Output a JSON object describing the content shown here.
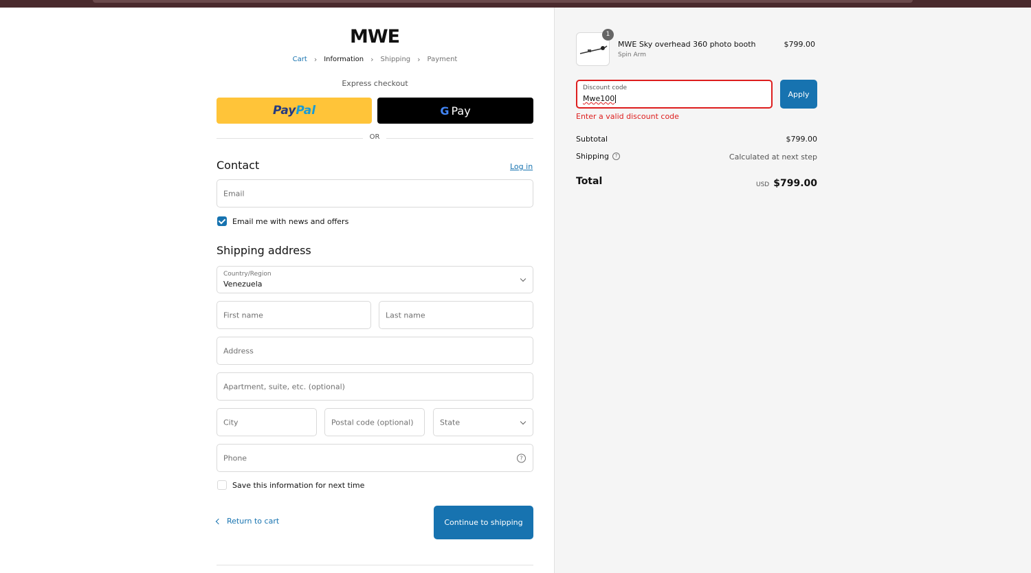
{
  "brand": {
    "logo_text": "MWE"
  },
  "breadcrumb": {
    "items": [
      {
        "label": "Cart"
      },
      {
        "label": "Information"
      },
      {
        "label": "Shipping"
      },
      {
        "label": "Payment"
      }
    ]
  },
  "express": {
    "title": "Express checkout",
    "paypal": {
      "pay": "Pay",
      "pal": "Pal"
    },
    "gpay": {
      "g": "G",
      "label": "Pay"
    },
    "or_text": "OR"
  },
  "contact": {
    "heading": "Contact",
    "login_label": "Log in",
    "email_placeholder": "Email",
    "newsletter_label": "Email me with news and offers",
    "newsletter_checked": true
  },
  "shipping": {
    "heading": "Shipping address",
    "country_label": "Country/Region",
    "country_value": "Venezuela",
    "first_name_placeholder": "First name",
    "last_name_placeholder": "Last name",
    "address_placeholder": "Address",
    "apartment_placeholder": "Apartment, suite, etc. (optional)",
    "city_placeholder": "City",
    "postal_placeholder": "Postal code (optional)",
    "state_placeholder": "State",
    "phone_placeholder": "Phone",
    "save_info_label": "Save this information for next time",
    "save_info_checked": false
  },
  "actions": {
    "return_label": "Return to cart",
    "continue_label": "Continue to shipping"
  },
  "order": {
    "item": {
      "quantity": "1",
      "name": "MWE Sky overhead 360 photo booth",
      "variant": "Spin Arm",
      "price": "$799.00"
    },
    "discount": {
      "label": "Discount code",
      "value": "Mwe100",
      "apply_label": "Apply",
      "error": "Enter a valid discount code"
    },
    "subtotal": {
      "label": "Subtotal",
      "value": "$799.00"
    },
    "shipping": {
      "label": "Shipping",
      "value": "Calculated at next step"
    },
    "total": {
      "label": "Total",
      "currency": "USD",
      "value": "$799.00"
    }
  },
  "colors": {
    "accent": "#1773b0",
    "error": "#dd1d1d",
    "paypal_yellow": "#ffc439"
  }
}
